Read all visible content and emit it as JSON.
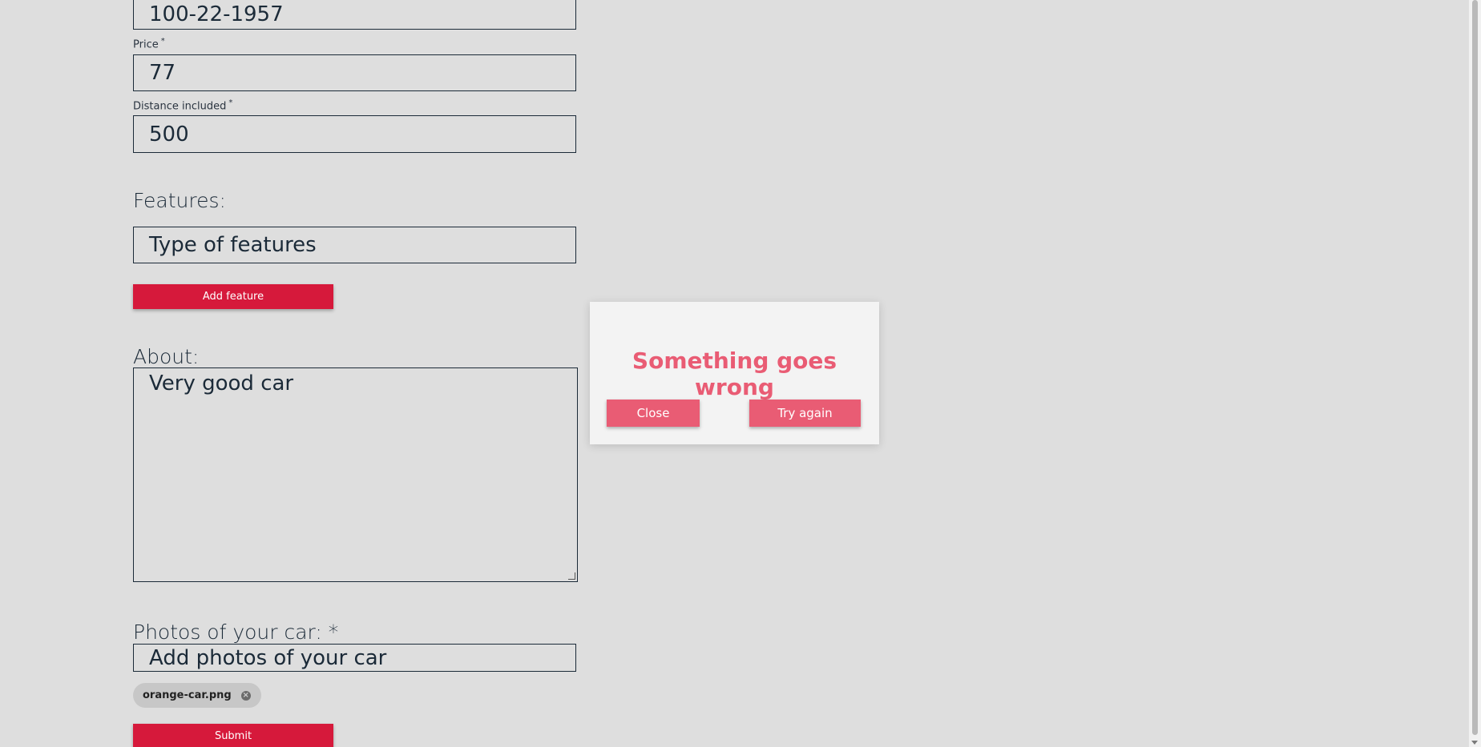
{
  "form": {
    "top_field_value": "100-22-1957",
    "price_label": "Price",
    "price_value": "77",
    "distance_label": "Distance included",
    "distance_value": "500",
    "required_mark": "*",
    "features_label": "Features:",
    "features_placeholder": "Type of features",
    "add_feature_label": "Add feature",
    "about_label": "About:",
    "about_value": "Very good car",
    "photos_label": "Photos of your car: *",
    "photos_placeholder": "Add photos of your car",
    "photo_chip": "orange-car.png",
    "chip_remove_icon": "×",
    "submit_label": "Submit"
  },
  "modal": {
    "title": "Something goes wrong",
    "close_label": "Close",
    "try_again_label": "Try again"
  },
  "colors": {
    "background": "#dedede",
    "primary_red": "#d6193b",
    "modal_pink": "#e95c74",
    "text_dark": "#1b2a38"
  }
}
